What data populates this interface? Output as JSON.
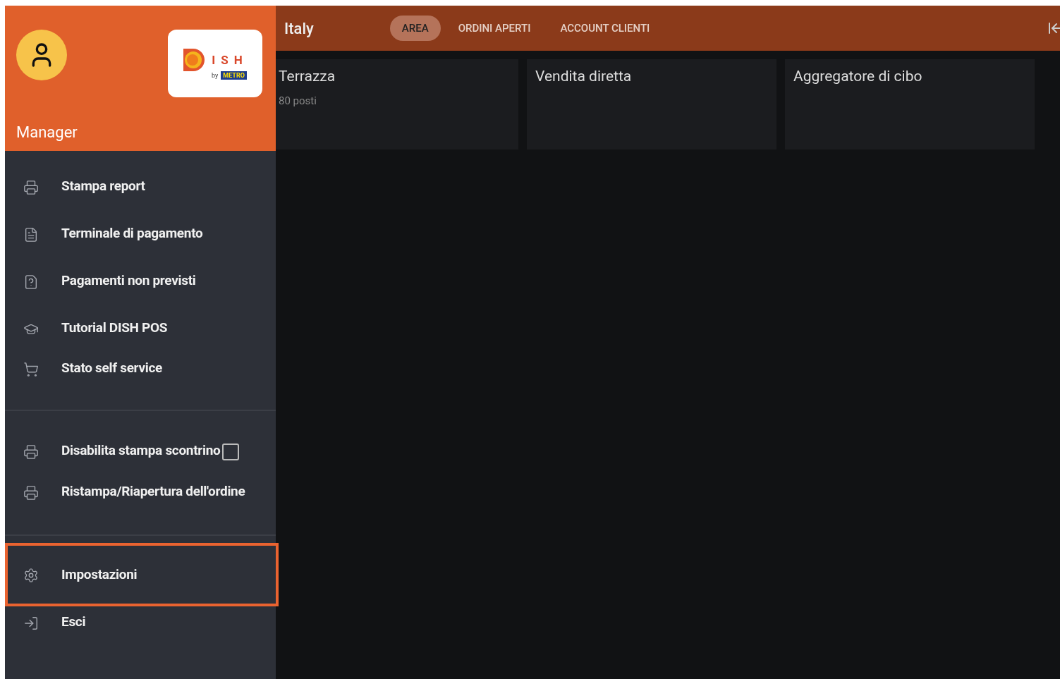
{
  "drawer": {
    "user": {
      "role": "Manager"
    },
    "logo": {
      "letters": "ISH",
      "by": "by",
      "brand": "METRO"
    },
    "groups": [
      {
        "items": [
          {
            "kind": "link",
            "label": "Stampa report",
            "highlighted": false
          },
          {
            "kind": "link",
            "label": "Terminale di pagamento",
            "highlighted": false
          },
          {
            "kind": "link",
            "label": "Pagamenti non previsti",
            "highlighted": false
          },
          {
            "kind": "link",
            "label": "Tutorial DISH POS",
            "highlighted": false
          },
          {
            "kind": "link",
            "label": "Stato self service",
            "highlighted": false
          }
        ]
      },
      {
        "items": [
          {
            "kind": "checkbox",
            "label": "Disabilita stampa scontrino",
            "checked": false,
            "highlighted": false
          },
          {
            "kind": "link",
            "label": "Ristampa/Riapertura dell'ordine",
            "highlighted": false
          }
        ]
      },
      {
        "items": [
          {
            "kind": "link",
            "label": "Impostazioni",
            "highlighted": true
          },
          {
            "kind": "link",
            "label": "Esci",
            "highlighted": false
          }
        ]
      }
    ]
  },
  "topbar": {
    "title": "Italy",
    "tabs": [
      {
        "label": "AREA",
        "selected": true
      },
      {
        "label": "ORDINI APERTI",
        "selected": false
      },
      {
        "label": "ACCOUNT CLIENTI",
        "selected": false
      }
    ]
  },
  "areas": [
    {
      "name": "Terrazza",
      "seats": "80 posti"
    },
    {
      "name": "Vendita diretta"
    },
    {
      "name": "Aggregatore di cibo"
    }
  ]
}
